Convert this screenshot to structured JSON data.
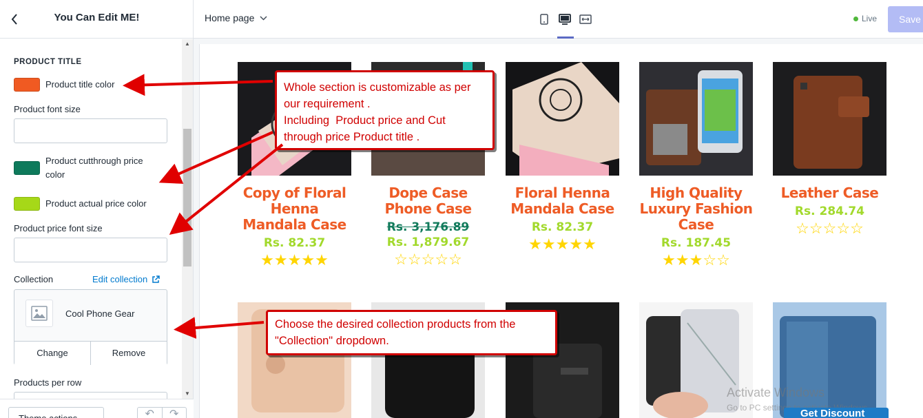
{
  "sidebar": {
    "title": "You Can Edit ME!",
    "section_heading": "PRODUCT TITLE",
    "title_color_label": "Product title color",
    "title_color": "#f05a22",
    "font_size_label": "Product font size",
    "cut_color_label": "Product cutthrough price color",
    "cut_color": "#0e7a5b",
    "actual_color_label": "Product actual price color",
    "actual_color": "#a6d818",
    "price_font_label": "Product price font size",
    "collection_label": "Collection",
    "edit_collection": "Edit collection",
    "collection_name": "Cool Phone Gear",
    "change": "Change",
    "remove": "Remove",
    "per_row_label": "Products per row",
    "theme_actions": "Theme actions"
  },
  "topbar": {
    "page": "Home page",
    "live": "Live",
    "save": "Save"
  },
  "products": [
    {
      "title": "Copy of Floral Henna Mandala Case",
      "price": "Rs. 82.37",
      "rating": 5
    },
    {
      "title": "Dope Case Phone Case",
      "cut_price": "Rs. 3,176.89",
      "price": "Rs. 1,879.67",
      "rating": 0
    },
    {
      "title": "Floral Henna Mandala Case",
      "price": "Rs. 82.37",
      "rating": 5
    },
    {
      "title": "High Quality Luxury Fashion Case",
      "price": "Rs. 187.45",
      "rating": 3
    },
    {
      "title": "Leather Case",
      "price": "Rs. 284.74",
      "rating": 0
    }
  ],
  "callouts": {
    "one": "Whole section is customizable as per our requirement .\nIncluding  Product price and Cut through price Product title .",
    "two": "Choose the desired collection products from the \"Collection\" dropdown."
  },
  "overlay": {
    "watermark": "Activate Windows",
    "watermark_sub": "Go to PC settings to activate Windows.",
    "discount": "Get Discount"
  }
}
